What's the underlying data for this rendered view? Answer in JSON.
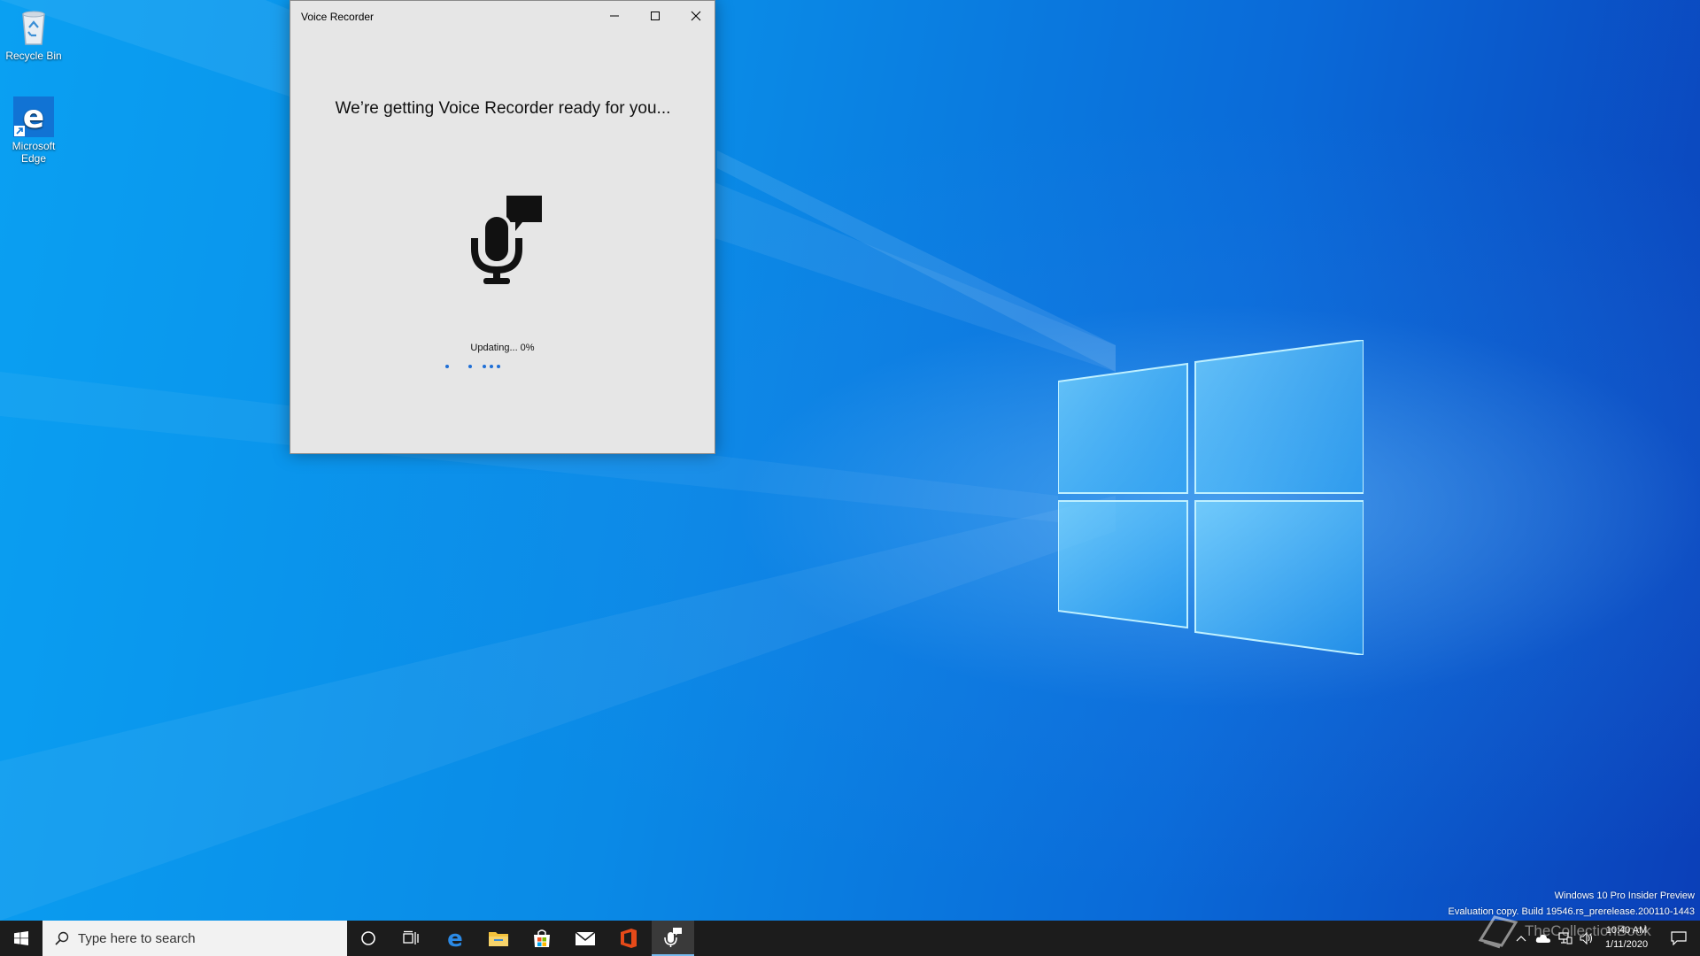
{
  "desktop": {
    "icons": [
      {
        "label": "Recycle Bin"
      },
      {
        "label_line1": "Microsoft",
        "label_line2": "Edge"
      }
    ],
    "watermark": {
      "line1": "Windows 10 Pro Insider Preview",
      "line2": "Evaluation copy. Build 19546.rs_prerelease.200110-1443"
    },
    "brand_watermark": "TheCollectionBook"
  },
  "window": {
    "title": "Voice Recorder",
    "heading": "We’re getting Voice Recorder ready for you...",
    "status": "Updating... 0%",
    "progress_percent": 0,
    "accent_color": "#1f6fd6"
  },
  "taskbar": {
    "search_placeholder": "Type here to search",
    "time": "10:40 AM",
    "date": "1/11/2020",
    "apps": [
      "start-icon",
      "cortana-icon",
      "task-view-icon",
      "edge-icon",
      "file-explorer-icon",
      "store-icon",
      "mail-icon",
      "office-icon",
      "voice-recorder-icon"
    ]
  }
}
